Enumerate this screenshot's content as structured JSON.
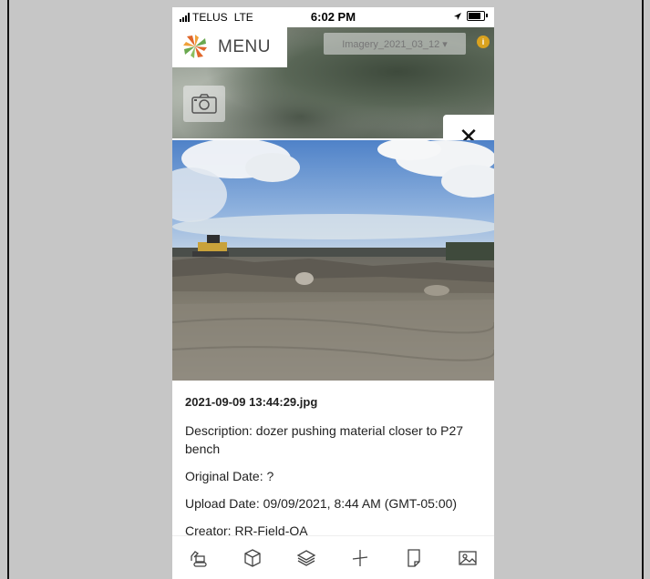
{
  "status_bar": {
    "carrier": "TELUS",
    "network": "LTE",
    "time": "6:02 PM"
  },
  "header": {
    "menu_label": "MENU",
    "imagery_selector": "Imagery_2021_03_12 ▾",
    "info_badge": "i"
  },
  "photo_viewer": {
    "close_label": "✕"
  },
  "details": {
    "filename": "2021-09-09 13:44:29.jpg",
    "description": "Description: dozer pushing material closer to P27 bench",
    "original_date": "Original Date: ?",
    "upload_date": "Upload Date: 09/09/2021, 8:44 AM (GMT-05:00)",
    "creator": "Creator: RR-Field-QA"
  },
  "toolbar": {
    "icons": [
      "excavator-icon",
      "box-3d-icon",
      "layers-icon",
      "measure-icon",
      "note-icon",
      "image-icon"
    ]
  },
  "colors": {
    "sky": "#6b97d2",
    "ground": "#7d7a6f",
    "logo_orange": "#e0662a",
    "logo_green": "#6aa84f",
    "info_badge": "#d9a21f"
  }
}
